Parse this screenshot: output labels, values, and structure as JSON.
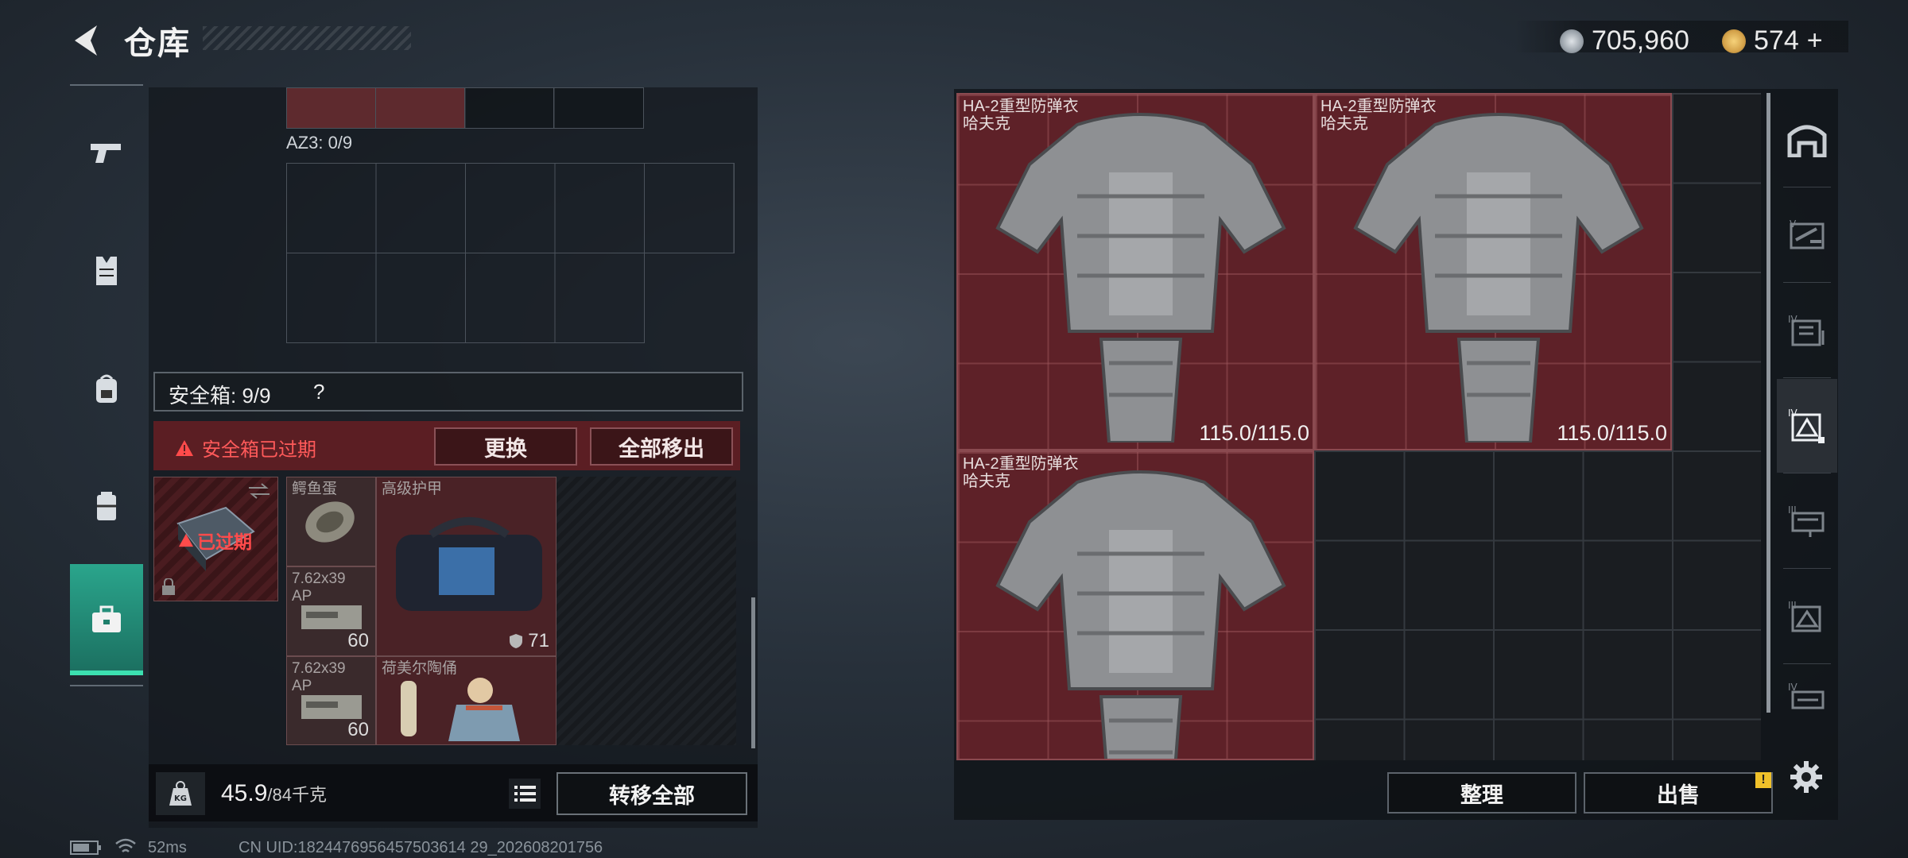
{
  "header": {
    "title": "仓库",
    "currency": [
      {
        "name": "coin-icon",
        "value": "705,960",
        "color": "#a9b0b8"
      },
      {
        "name": "bond-icon",
        "value": "574",
        "suffix": "+",
        "color": "#d4a24a"
      }
    ]
  },
  "left_sidebar": {
    "items": [
      "pistol-icon",
      "armor-vest-icon",
      "backpack-icon",
      "chest-rig-icon",
      "briefcase-icon"
    ],
    "active_index": 4
  },
  "container": {
    "az3_label": "AZ3: 0/9",
    "safe_box_label": "安全箱: 9/9",
    "safe_box_help": "?",
    "expired_text": "安全箱已过期",
    "expired_badge": "已过期",
    "replace_button": "更换",
    "remove_all_button": "全部移出",
    "items": [
      {
        "name": "鳄鱼蛋",
        "count": ""
      },
      {
        "name": "高级护甲",
        "count": "71"
      },
      {
        "name": "7.62x39 AP",
        "count": "60"
      },
      {
        "name": "7.62x39 AP",
        "count": "60"
      },
      {
        "name": "荷美尔陶俑",
        "count": ""
      }
    ]
  },
  "weight": {
    "current": "45.9",
    "max_unit": "/84千克",
    "kg_badge": "KG"
  },
  "transfer_all_button": "转移全部",
  "status": {
    "ping": "52ms",
    "uid": "CN UID:1824476956457503614 29_202608201756"
  },
  "stash": {
    "items": [
      {
        "name": "HA-2重型防弹衣",
        "sub": "哈夫克",
        "durability": "115.0/115.0"
      },
      {
        "name": "HA-2重型防弹衣",
        "sub": "哈夫克",
        "durability": "115.0/115.0"
      },
      {
        "name": "HA-2重型防弹衣",
        "sub": "哈夫克",
        "durability": ""
      }
    ],
    "sort_button": "整理",
    "sell_button": "出售",
    "sell_badge": "!"
  },
  "right_sidebar": {
    "items": [
      "home-stash-icon",
      "tier-v-icon",
      "tier-iv-icon",
      "tier-iv-active-icon",
      "tier-iii-icon",
      "tier-iii-armor-icon",
      "tier-iv-rig-icon"
    ],
    "active_index": 3
  }
}
